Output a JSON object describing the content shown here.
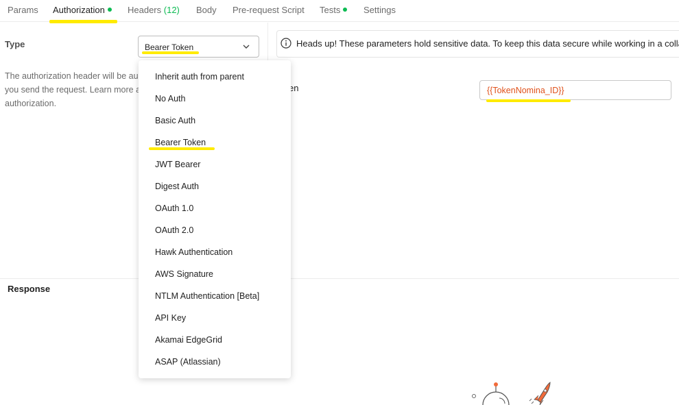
{
  "tabs": [
    {
      "label": "Params"
    },
    {
      "label": "Authorization"
    },
    {
      "label": "Headers",
      "count": "(12)"
    },
    {
      "label": "Body"
    },
    {
      "label": "Pre-request Script"
    },
    {
      "label": "Tests"
    },
    {
      "label": "Settings"
    }
  ],
  "auth": {
    "type_label": "Type",
    "selected_type": "Bearer Token",
    "description_lines": [
      "The authorization header will be au",
      "you send the request. Learn more a",
      "authorization."
    ]
  },
  "notice": {
    "message": "Heads up! These parameters hold sensitive data. To keep this data secure while working in a collabo"
  },
  "token": {
    "label": "en",
    "value": "{{TokenNomina_ID}}"
  },
  "response": {
    "label": "Response"
  },
  "dropdown": {
    "options": [
      "Inherit auth from parent",
      "No Auth",
      "Basic Auth",
      "Bearer Token",
      "JWT Bearer",
      "Digest Auth",
      "OAuth 1.0",
      "OAuth 2.0",
      "Hawk Authentication",
      "AWS Signature",
      "NTLM Authentication [Beta]",
      "API Key",
      "Akamai EdgeGrid",
      "ASAP (Atlassian)"
    ]
  },
  "colors": {
    "highlight": "#ffeb00",
    "status_dot": "#0cbb52",
    "variable_text": "#e0521c",
    "rocket": "#f26b3a"
  }
}
